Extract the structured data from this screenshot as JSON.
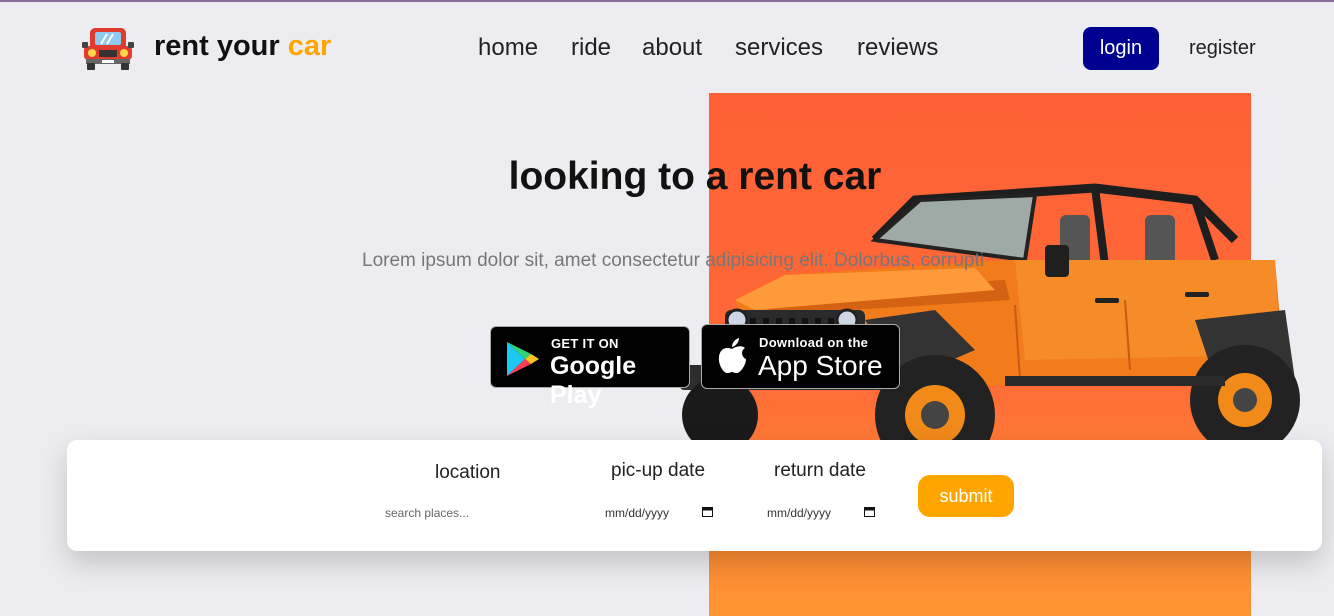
{
  "header": {
    "brand_main": "rent your",
    "brand_accent": "car",
    "nav": [
      "home",
      "ride",
      "about",
      "services",
      "reviews"
    ],
    "login_label": "login",
    "register_label": "register"
  },
  "hero": {
    "title": "looking to a rent car",
    "subtitle": "Lorem ipsum dolor sit, amet consectetur adipisicing elit. Dolorbus, corrupti"
  },
  "stores": {
    "google": {
      "small": "GET IT ON",
      "big": "Google Play"
    },
    "apple": {
      "small": "Download on the",
      "big": "App Store"
    }
  },
  "booking": {
    "location_label": "location",
    "location_placeholder": "search places...",
    "pickup_label": "pic-up date",
    "pickup_value": "mm/dd/yyyy",
    "return_label": "return date",
    "return_value": "mm/dd/yyyy",
    "submit_label": "submit"
  },
  "colors": {
    "accent": "#ffa500",
    "login_bg": "#000090",
    "hero_panel": "#ff6037"
  }
}
